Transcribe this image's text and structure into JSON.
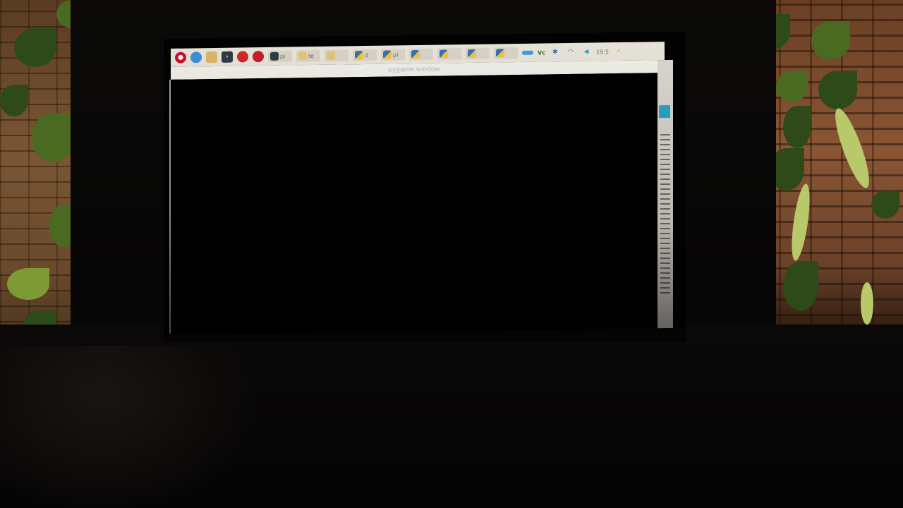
{
  "window": {
    "title": "pygame window"
  },
  "taskbar": {
    "tasks": [
      {
        "label": "pi",
        "icon": "terminal-icon"
      },
      {
        "label": "te",
        "icon": "folder-icon"
      },
      {
        "label": "",
        "icon": "folder-icon"
      },
      {
        "label": "d",
        "icon": "python-icon"
      },
      {
        "label": "pl",
        "icon": "python-icon"
      },
      {
        "label": "",
        "icon": "python-icon"
      },
      {
        "label": "",
        "icon": "python-icon"
      },
      {
        "label": "",
        "icon": "python-icon"
      },
      {
        "label": "",
        "icon": "python-icon"
      }
    ],
    "tray": {
      "vnc_label": "Vc",
      "clock": "19:5"
    }
  },
  "colors": {
    "taskbar": "#e7e3d8",
    "raspberry": "#c8102e",
    "accent": "#2aa7c8"
  }
}
